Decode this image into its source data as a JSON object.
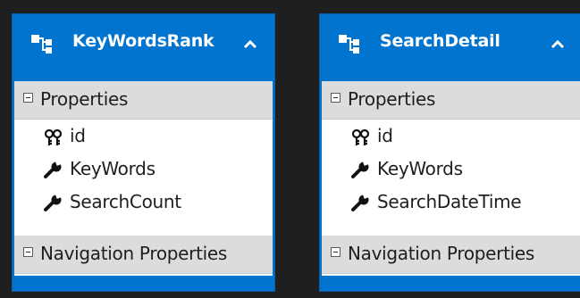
{
  "entities": [
    {
      "title": "KeyWordsRank",
      "sections": {
        "properties_label": "Properties",
        "navigation_label": "Navigation Properties"
      },
      "properties": [
        {
          "name": "id",
          "icon": "key-icon"
        },
        {
          "name": "KeyWords",
          "icon": "wrench-icon"
        },
        {
          "name": "SearchCount",
          "icon": "wrench-icon"
        }
      ]
    },
    {
      "title": "SearchDetail",
      "sections": {
        "properties_label": "Properties",
        "navigation_label": "Navigation Properties"
      },
      "properties": [
        {
          "name": "id",
          "icon": "key-icon"
        },
        {
          "name": "KeyWords",
          "icon": "wrench-icon"
        },
        {
          "name": "SearchDateTime",
          "icon": "wrench-icon"
        }
      ]
    }
  ],
  "colors": {
    "canvas_background": "#1f1f1f",
    "entity_header": "#0074cf",
    "section_header": "#dcdcdc",
    "text": "#1e1e1e"
  }
}
